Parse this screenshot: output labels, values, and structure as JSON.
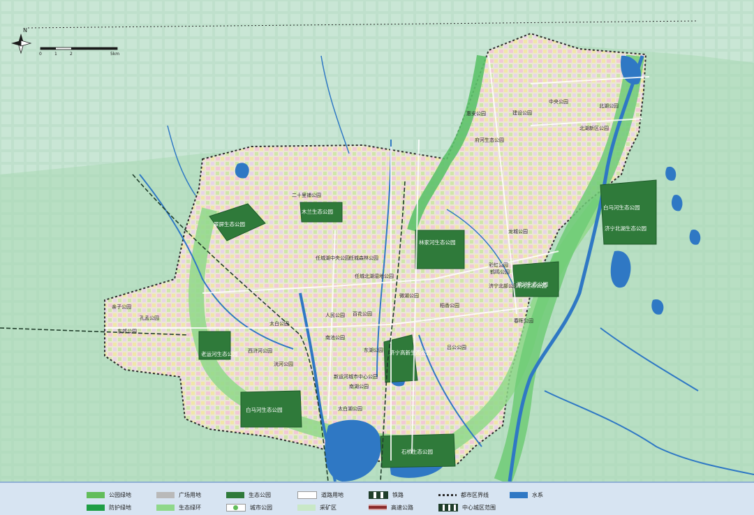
{
  "colors": {
    "background": "#cfe6dc",
    "urban_base": "#e9e4cf",
    "park_green": "#62bd5a",
    "protection_green": "#1f9e45",
    "eco_park": "#2f7a3a",
    "eco_ring": "#8fd88a",
    "water": "#2f78c4",
    "road": "#ffffff",
    "legend_bg": "#d7e4f2"
  },
  "compass": {
    "letter": "N"
  },
  "scale_bar": {
    "ticks": [
      "0",
      "1",
      "2",
      "5km"
    ]
  },
  "park_labels": [
    "二十里铺公园",
    "木兰生态公园",
    "翠屏生态公园",
    "任城湖中央公园",
    "任城森林公园",
    "任城北湖湿地公园",
    "人民公园",
    "百花公园",
    "太白公园",
    "南池公园",
    "西浒河公园",
    "洸河公园",
    "微湖公园",
    "济宁高新生态公园",
    "东湖公园",
    "新运河城市中心公园",
    "太白湖公园",
    "南湖公园",
    "东郊公园",
    "老运河生态公园",
    "孔孟公园",
    "亲子公园",
    "林家河生态公园",
    "彩虹公园",
    "泗河生态公园",
    "惠安公园",
    "龙城公园",
    "建设公园",
    "中央公园",
    "北湖公园",
    "府河生态公园",
    "稻香公园",
    "北湖新区公园",
    "白马河生态公园",
    "济宁北部公园",
    "鹤鸣公园",
    "春晖公园",
    "吕公公园"
  ],
  "eco_park_labels": [
    "白马河生态公园",
    "泗河生态公园",
    "石桥生态公园",
    "济宁北湖生态公园"
  ],
  "legend": {
    "items": [
      {
        "label": "公园绿地",
        "color": "#62bd5a",
        "type": "solid"
      },
      {
        "label": "广场用地",
        "color": "#b9b9b9",
        "type": "solid"
      },
      {
        "label": "生态公园",
        "color": "#2f7a3a",
        "type": "solid"
      },
      {
        "label": "道路用地",
        "color": "#ffffff",
        "type": "road"
      },
      {
        "label": "铁路",
        "color": "#1f3d2a",
        "type": "rail"
      },
      {
        "label": "都市区界线",
        "color": "#2a2a2a",
        "type": "dashed"
      },
      {
        "label": "水系",
        "color": "#2f78c4",
        "type": "solid"
      },
      {
        "label": "防护绿地",
        "color": "#1f9e45",
        "type": "solid"
      },
      {
        "label": "生态绿环",
        "color": "#8fd88a",
        "type": "solid"
      },
      {
        "label": "城市公园",
        "color": "#62bd5a",
        "type": "dot"
      },
      {
        "label": "采矿区",
        "color": "#c9e8c7",
        "type": "solid"
      },
      {
        "label": "高速公路",
        "color": "#8a2b2b",
        "type": "highway"
      },
      {
        "label": "中心城区范围",
        "color": "#1f3d2a",
        "type": "dashline"
      }
    ]
  }
}
